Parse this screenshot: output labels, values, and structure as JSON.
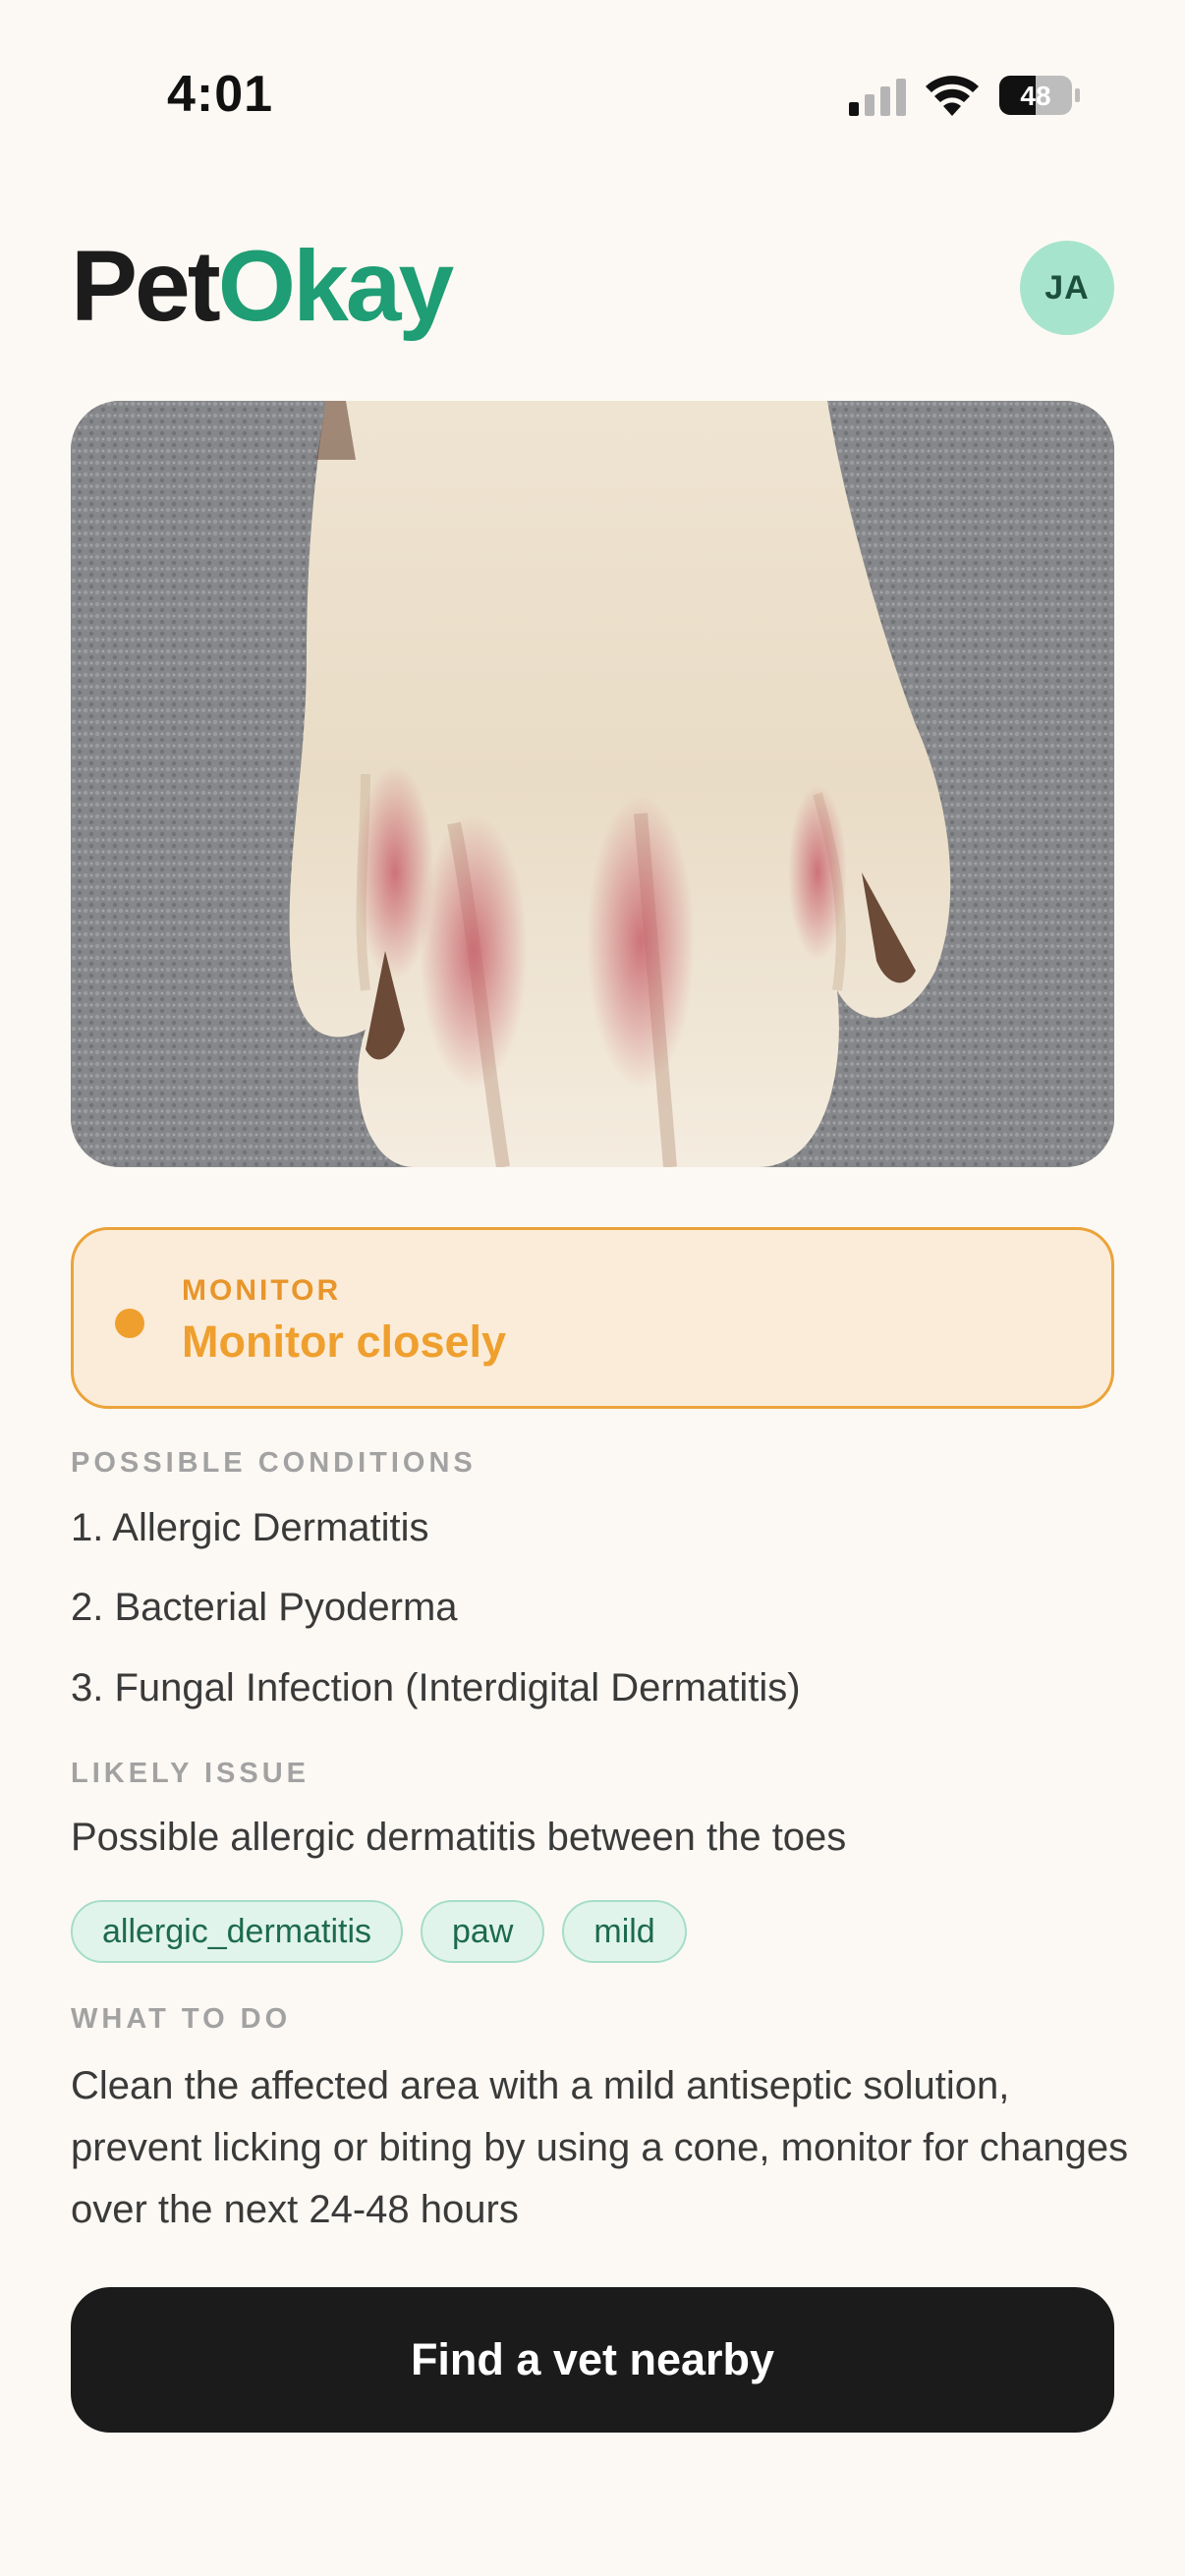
{
  "status_bar": {
    "time": "4:01",
    "battery": "48"
  },
  "header": {
    "logo_part1": "Pet",
    "logo_part2": "Okay",
    "avatar_initials": "JA"
  },
  "result": {
    "severity_label": "MONITOR",
    "severity_title": "Monitor closely",
    "severity_color": "#ef9f2e"
  },
  "possible_conditions": {
    "label": "POSSIBLE CONDITIONS",
    "items": [
      "1. Allergic Dermatitis",
      "2. Bacterial Pyoderma",
      "3. Fungal Infection (Interdigital Dermatitis)"
    ]
  },
  "likely_issue": {
    "label": "LIKELY ISSUE",
    "text": "Possible allergic dermatitis between the toes"
  },
  "tags": [
    "allergic_dermatitis",
    "paw",
    "mild"
  ],
  "what_to_do": {
    "label": "WHAT TO DO",
    "text": "Clean the affected area with a mild antiseptic solution, prevent licking or biting by using a cone, monitor for changes over the next 24-48 hours"
  },
  "cta": {
    "label": "Find a vet nearby"
  },
  "colors": {
    "brand_green": "#1f9d74",
    "warning_orange": "#ef9f2e",
    "background": "#fcf9f4"
  }
}
